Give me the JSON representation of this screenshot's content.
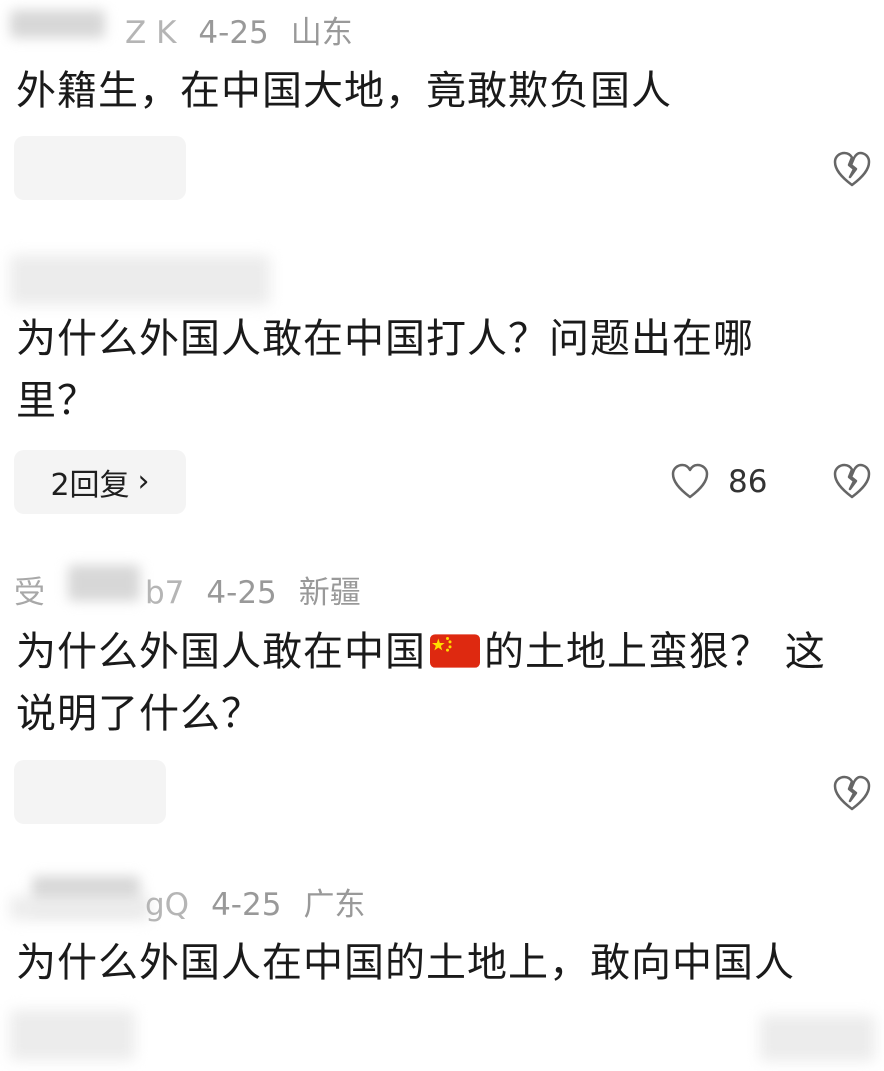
{
  "comments": [
    {
      "meta": {
        "name_tail": "Z K",
        "date": "4-25",
        "location": "山东"
      },
      "text": "外籍生，在中国大地，竟敢欺负国人"
    },
    {
      "text_line1": "为什么外国人敢在中国打人？问题出在哪",
      "text_line2": "里？",
      "reply_label": "2回复",
      "reply_chevron": "›",
      "like_count": "86"
    },
    {
      "meta": {
        "name_head": "受",
        "name_tail": "b7",
        "date": "4-25",
        "location": "新疆"
      },
      "text_before_flag": "为什么外国人敢在中国",
      "text_after_flag": "的土地上蛮狠？ 这",
      "text_line2": "说明了什么？"
    },
    {
      "meta": {
        "name_tail": "gQ",
        "date": "4-25",
        "location": "广东"
      },
      "text": "为什么外国人在中国的土地上，敢向中国人"
    }
  ],
  "icons": {
    "heart": "heart-icon",
    "dislike": "broken-heart-icon",
    "flag": "china-flag-emoji"
  },
  "colors": {
    "text": "#1a1a1a",
    "meta": "#999999",
    "pill": "#f4f4f4",
    "flag_red": "#de2910",
    "flag_gold": "#ffde00"
  }
}
